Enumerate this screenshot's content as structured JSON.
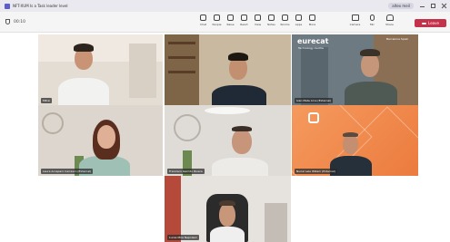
{
  "window": {
    "title": "NFT-XUM Is a Task leader level",
    "user": "altex meil"
  },
  "meeting": {
    "timer": "00:10"
  },
  "toolbar": {
    "tools": [
      {
        "label": "Chat",
        "icon": "chat-icon"
      },
      {
        "label": "People",
        "icon": "people-icon"
      },
      {
        "label": "Raise",
        "icon": "raise-hand-icon"
      },
      {
        "label": "React",
        "icon": "react-icon"
      },
      {
        "label": "View",
        "icon": "view-icon"
      },
      {
        "label": "Notes",
        "icon": "notes-icon"
      },
      {
        "label": "Rooms",
        "icon": "rooms-icon"
      },
      {
        "label": "Apps",
        "icon": "apps-icon"
      },
      {
        "label": "More",
        "icon": "more-icon"
      }
    ],
    "devices": [
      {
        "label": "Camera",
        "icon": "camera-icon"
      },
      {
        "label": "Mic",
        "icon": "mic-icon"
      },
      {
        "label": "Share",
        "icon": "share-icon"
      }
    ],
    "leave_label": "Leave"
  },
  "participants": [
    {
      "name": "Mihai"
    },
    {
      "name": ""
    },
    {
      "name": "Ivan Mete Arce (External)"
    },
    {
      "name": "Laura Acosparo Carrasco (External)"
    },
    {
      "name": "Francisco Garrido Rivera"
    },
    {
      "name": "Nuriel Lele Willam (External)"
    },
    {
      "name": "Lucas Mire Nepoleon"
    }
  ],
  "overlays": {
    "eurecat_logo": "eurecat",
    "eurecat_tagline": "Technology Centre",
    "building_caption": "Barcelona Spain"
  },
  "colors": {
    "accent": "#5b5fc7",
    "leave": "#c4314b",
    "orange_bg": "#f0894e"
  }
}
